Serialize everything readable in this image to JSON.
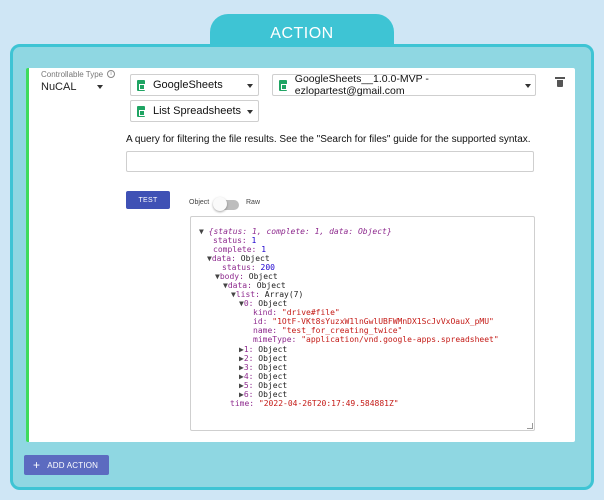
{
  "header": {
    "title": "ACTION"
  },
  "action_card": {
    "controllable_type": {
      "label": "Controllable Type",
      "value": "NuCAL"
    },
    "integration": {
      "value": "GoogleSheets"
    },
    "account": {
      "value": "GoogleSheets__1.0.0-MVP - ezlopartest@gmail.com"
    },
    "method": {
      "value": "List Spreadsheets"
    },
    "query": {
      "description": "A query for filtering the file results. See the \"Search for files\" guide for the supported syntax.",
      "value": "",
      "placeholder": ""
    },
    "test_label": "TEST",
    "view_toggle": {
      "left": "Object",
      "right": "Raw"
    },
    "result": {
      "summary": "{status: 1, complete: 1, data: Object}",
      "status_key": "status:",
      "status_val": "1",
      "complete_key": "complete:",
      "complete_val": "1",
      "data_key": "data:",
      "data_val": "Object",
      "inner_status_key": "status:",
      "inner_status_val": "200",
      "body_key": "body:",
      "body_val": "Object",
      "body_data_key": "data:",
      "body_data_val": "Object",
      "list_key": "list:",
      "list_val": "Array(7)",
      "item0_key": "0:",
      "item0_val": "Object",
      "kind_key": "kind:",
      "kind_val": "\"drive#file\"",
      "id_key": "id:",
      "id_val": "\"1OtF-VKt8sYuzxW1lnGwlUBFWMnDX1ScJvVxOauX_pMU\"",
      "name_key": "name:",
      "name_val": "\"test_for_creating_twice\"",
      "mime_key": "mimeType:",
      "mime_val": "\"application/vnd.google-apps.spreadsheet\"",
      "collapsed_items": [
        {
          "key": "1:",
          "val": "Object"
        },
        {
          "key": "2:",
          "val": "Object"
        },
        {
          "key": "3:",
          "val": "Object"
        },
        {
          "key": "4:",
          "val": "Object"
        },
        {
          "key": "5:",
          "val": "Object"
        },
        {
          "key": "6:",
          "val": "Object"
        }
      ],
      "time_key": "time:",
      "time_val": "\"2022-04-26T20:17:49.584881Z\""
    }
  },
  "add_action_label": "ADD ACTION",
  "colors": {
    "accent": "#3ec4d4",
    "panel": "#8fd7e2",
    "primary_button": "#3f51b5",
    "card_border": "#3ddc5c"
  }
}
